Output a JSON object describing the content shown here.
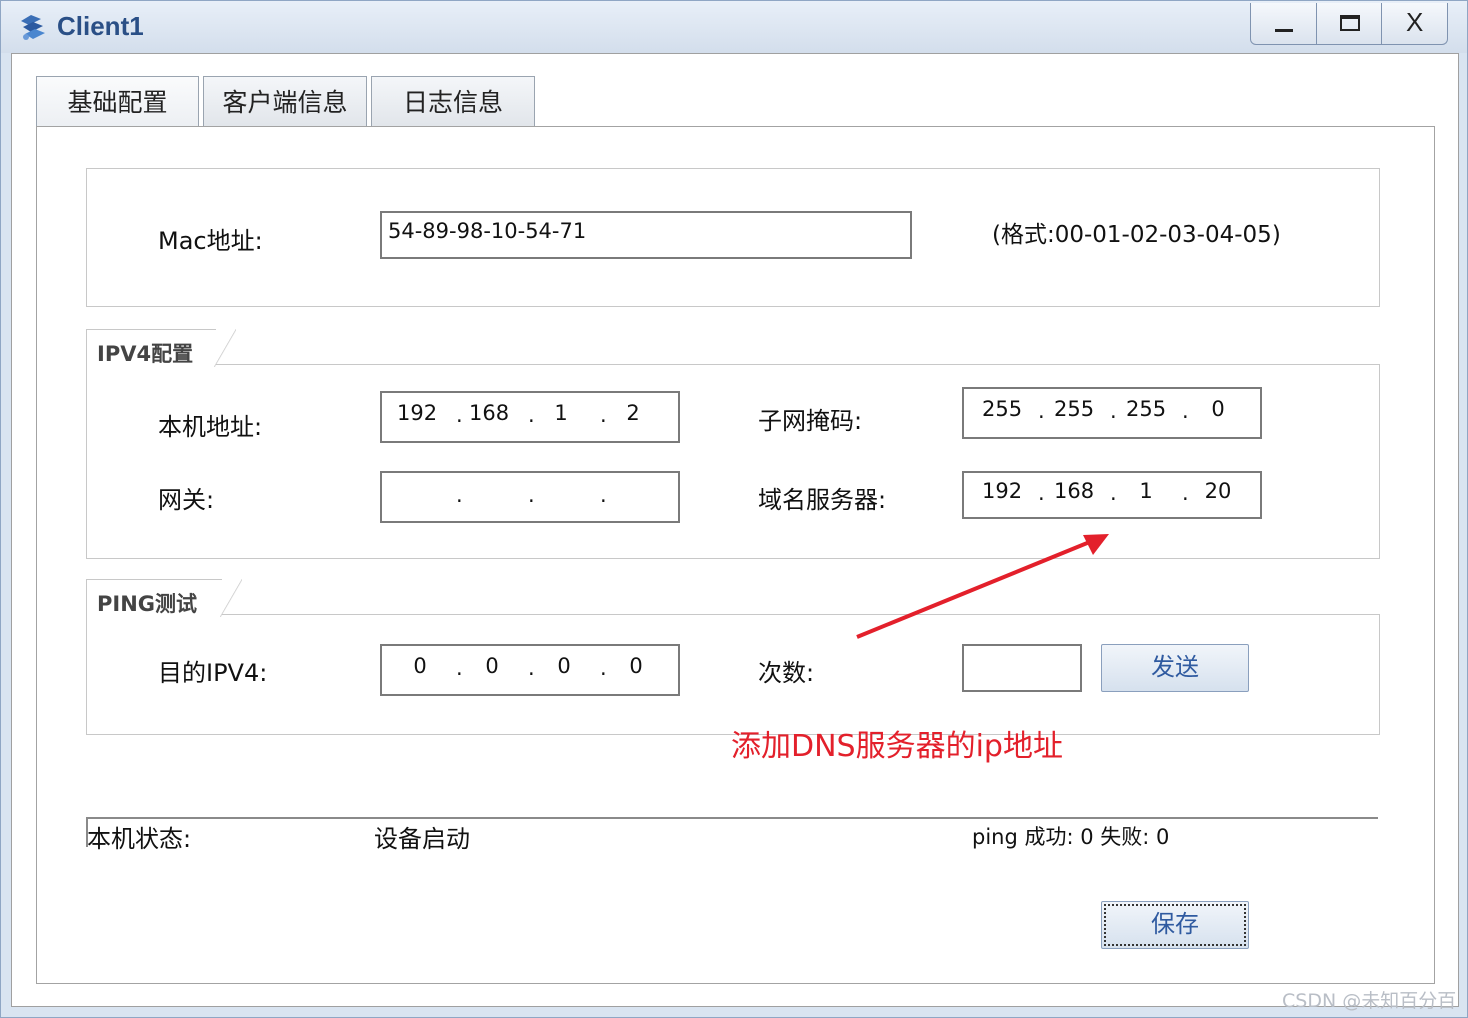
{
  "window": {
    "title": "Client1",
    "close_label": "X"
  },
  "tabs": [
    {
      "label": "基础配置",
      "active": true
    },
    {
      "label": "客户端信息",
      "active": false
    },
    {
      "label": "日志信息",
      "active": false
    }
  ],
  "mac": {
    "label": "Mac地址:",
    "value": "54-89-98-10-54-71",
    "format_hint": "(格式:00-01-02-03-04-05)"
  },
  "ipv4": {
    "group_title": "IPV4配置",
    "local_ip_label": "本机地址:",
    "local_ip": [
      "192",
      "168",
      "1",
      "2"
    ],
    "subnet_label": "子网掩码:",
    "subnet": [
      "255",
      "255",
      "255",
      "0"
    ],
    "gateway_label": "网关:",
    "gateway": [
      "",
      "",
      "",
      ""
    ],
    "dns_label": "域名服务器:",
    "dns": [
      "192",
      "168",
      "1",
      "20"
    ]
  },
  "ping": {
    "group_title": "PING测试",
    "target_label": "目的IPV4:",
    "target": [
      "0",
      "0",
      "0",
      "0"
    ],
    "count_label": "次数:",
    "count_value": "",
    "send_label": "发送"
  },
  "annotation": {
    "text": "添加DNS服务器的ip地址",
    "color": "#e3202b"
  },
  "status": {
    "label": "本机状态:",
    "value": "设备启动",
    "ping_result": "ping 成功: 0 失败: 0"
  },
  "save_label": "保存",
  "watermark": "CSDN @未知百分百",
  "colors": {
    "title_text": "#2a4f86",
    "button_text": "#2f5aa0",
    "window_frame": "#d9e4f1"
  }
}
